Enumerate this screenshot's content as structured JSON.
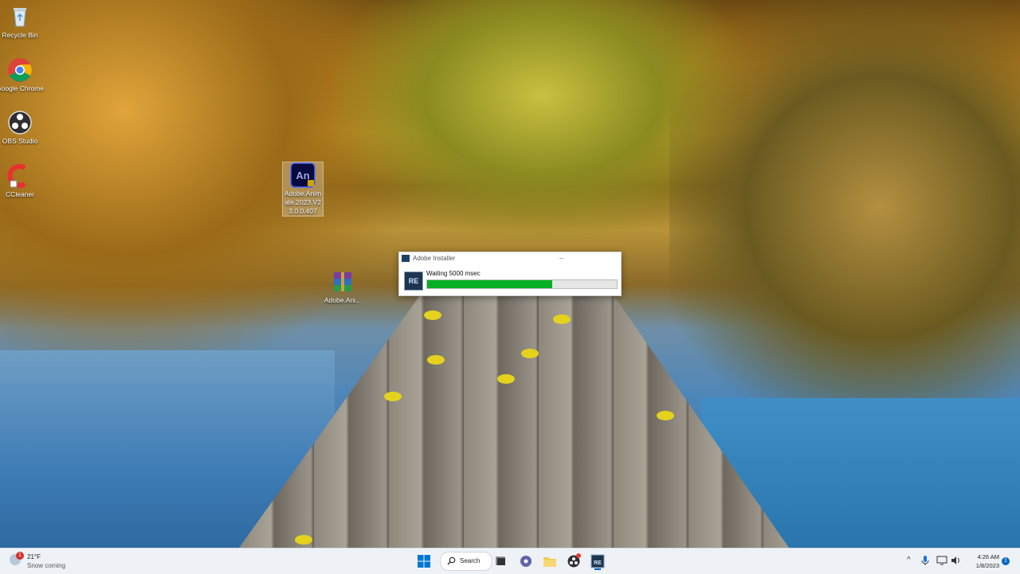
{
  "desktop_icons": [
    {
      "label": "Recycle Bin",
      "icon": "recycle-bin-icon"
    },
    {
      "label": "Google Chrome",
      "icon": "chrome-icon"
    },
    {
      "label": "OBS Studio",
      "icon": "obs-icon"
    },
    {
      "label": "CCleaner",
      "icon": "ccleaner-icon"
    },
    {
      "label": "Adobe.Animate.2023.V23.0.0.407",
      "icon": "adobe-animate-icon"
    },
    {
      "label": "Adobe.Ani...",
      "icon": "winrar-archive-icon"
    }
  ],
  "installer_window": {
    "title": "Adobe Installer",
    "minimize_glyph": "–",
    "app_icon_text": "RE",
    "status_text": "Waiting 5000 msec",
    "progress": 0.66,
    "progress_color": "#06b025"
  },
  "taskbar": {
    "weather": {
      "badge": "1",
      "temp": "21°F",
      "condition": "Snow coming"
    },
    "search_label": "Search",
    "apps": [
      "windows-start-icon",
      "search-icon",
      "task-view-icon",
      "teams-chat-icon",
      "file-explorer-icon",
      "obs-icon",
      "re-installer-icon"
    ],
    "tray": {
      "chevron": "^",
      "icons": [
        "microphone-icon",
        "network-icon",
        "volume-icon"
      ]
    },
    "clock": {
      "time": "4:26 AM",
      "date": "1/8/2023"
    },
    "notification_count": "1"
  }
}
